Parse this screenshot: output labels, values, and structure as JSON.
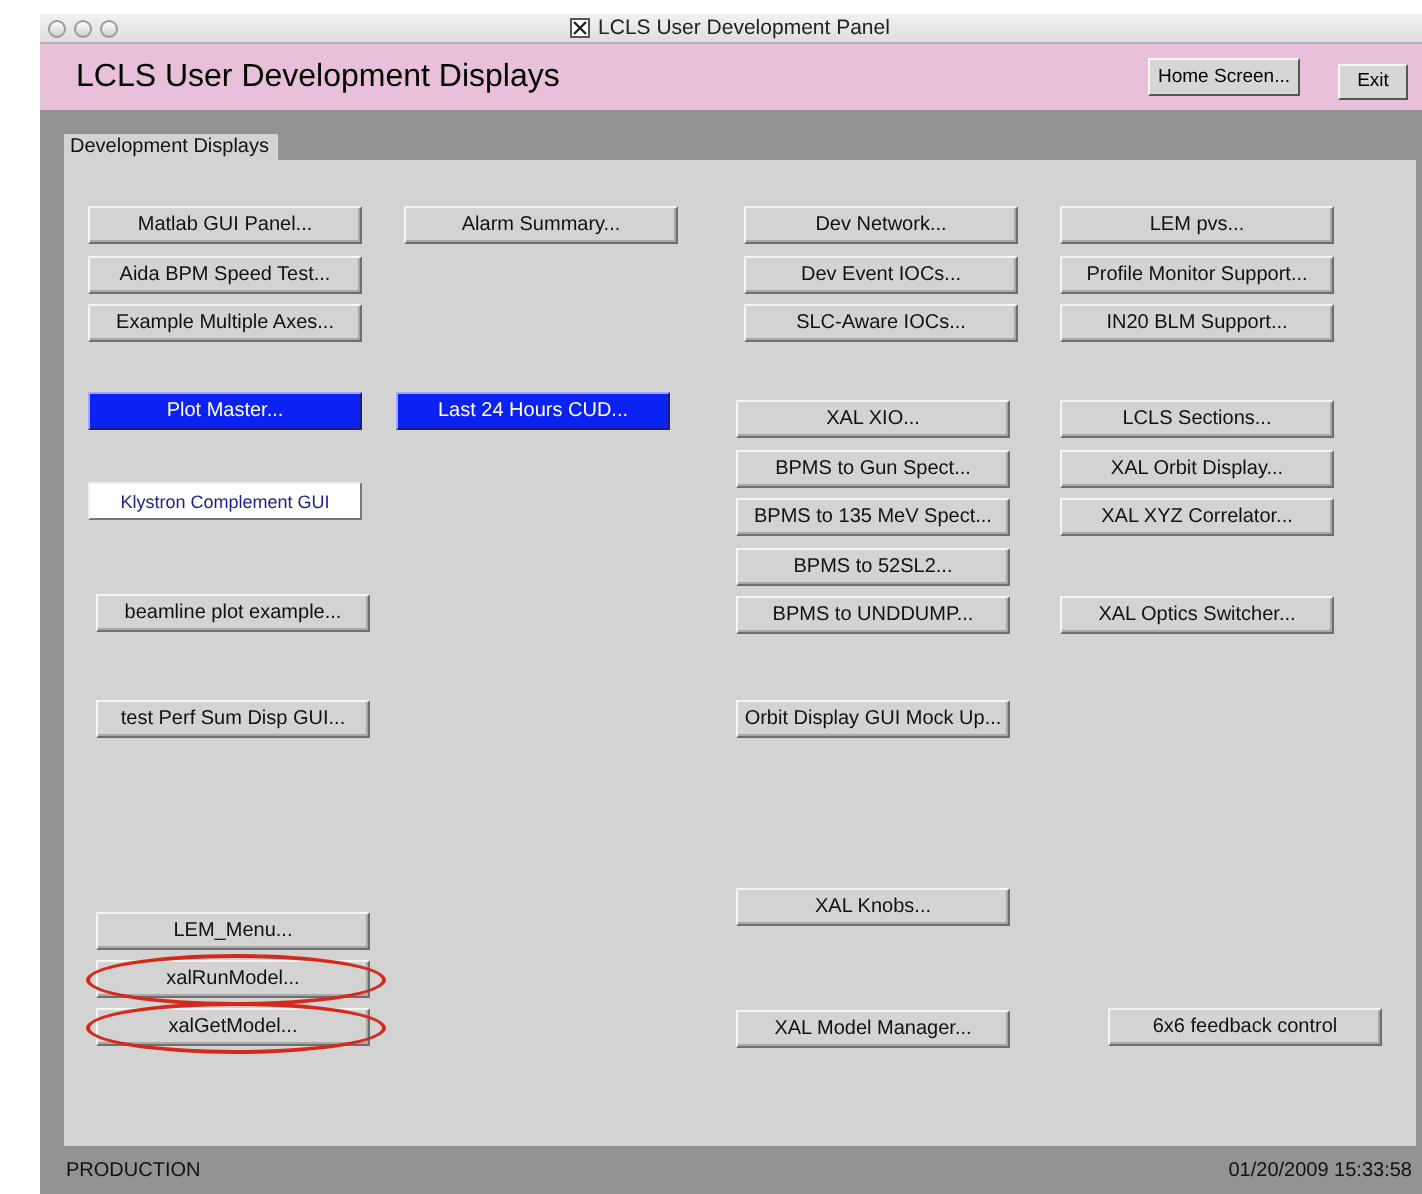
{
  "window": {
    "title": "LCLS User Development Panel"
  },
  "header": {
    "title": "LCLS User Development Displays",
    "buttons": [
      "Home Screen...",
      "Exit"
    ]
  },
  "panel": {
    "label": "Development Displays",
    "columns": [
      [
        {
          "label": "Matlab GUI Panel...",
          "kind": "normal",
          "annotated": false
        },
        {
          "label": "Aida BPM Speed Test...",
          "kind": "normal",
          "annotated": false
        },
        {
          "label": "Example Multiple Axes...",
          "kind": "normal",
          "annotated": false
        },
        {
          "label": "Plot Master...",
          "kind": "highlighted",
          "annotated": false
        },
        {
          "label": "Klystron Complement GUI",
          "kind": "white",
          "annotated": false
        },
        {
          "label": "beamline plot example...",
          "kind": "normal",
          "annotated": false
        },
        {
          "label": "test Perf Sum Disp GUI...",
          "kind": "normal",
          "annotated": false
        },
        {
          "label": "LEM_Menu...",
          "kind": "normal",
          "annotated": false
        },
        {
          "label": "xalRunModel...",
          "kind": "normal",
          "annotated": true
        },
        {
          "label": "xalGetModel...",
          "kind": "normal",
          "annotated": true
        }
      ],
      [
        {
          "label": "Alarm Summary...",
          "kind": "normal",
          "annotated": false
        },
        {
          "label": "Last 24 Hours CUD...",
          "kind": "highlighted",
          "annotated": false
        }
      ],
      [
        {
          "label": "Dev Network...",
          "kind": "normal",
          "annotated": false
        },
        {
          "label": "Dev Event IOCs...",
          "kind": "normal",
          "annotated": false
        },
        {
          "label": "SLC-Aware IOCs...",
          "kind": "normal",
          "annotated": false
        },
        {
          "label": "XAL XIO...",
          "kind": "normal",
          "annotated": false
        },
        {
          "label": "BPMS to Gun Spect...",
          "kind": "normal",
          "annotated": false
        },
        {
          "label": "BPMS to 135 MeV Spect...",
          "kind": "normal",
          "annotated": false
        },
        {
          "label": "BPMS to 52SL2...",
          "kind": "normal",
          "annotated": false
        },
        {
          "label": "BPMS to UNDDUMP...",
          "kind": "normal",
          "annotated": false
        },
        {
          "label": "Orbit Display GUI Mock Up...",
          "kind": "normal",
          "annotated": false
        },
        {
          "label": "XAL Knobs...",
          "kind": "normal",
          "annotated": false
        },
        {
          "label": "XAL Model Manager...",
          "kind": "normal",
          "annotated": false
        }
      ],
      [
        {
          "label": "LEM pvs...",
          "kind": "normal",
          "annotated": false
        },
        {
          "label": "Profile Monitor Support...",
          "kind": "normal",
          "annotated": false
        },
        {
          "label": "IN20 BLM Support...",
          "kind": "normal",
          "annotated": false
        },
        {
          "label": "LCLS Sections...",
          "kind": "normal",
          "annotated": false
        },
        {
          "label": "XAL Orbit Display...",
          "kind": "normal",
          "annotated": false
        },
        {
          "label": "XAL XYZ Correlator...",
          "kind": "normal",
          "annotated": false
        },
        {
          "label": "XAL Optics Switcher...",
          "kind": "normal",
          "annotated": false
        },
        {
          "label": "6x6 feedback control",
          "kind": "normal",
          "annotated": false
        }
      ]
    ]
  },
  "status_bar": {
    "mode": "PRODUCTION",
    "timestamp": "01/20/2009 15:33:58"
  }
}
